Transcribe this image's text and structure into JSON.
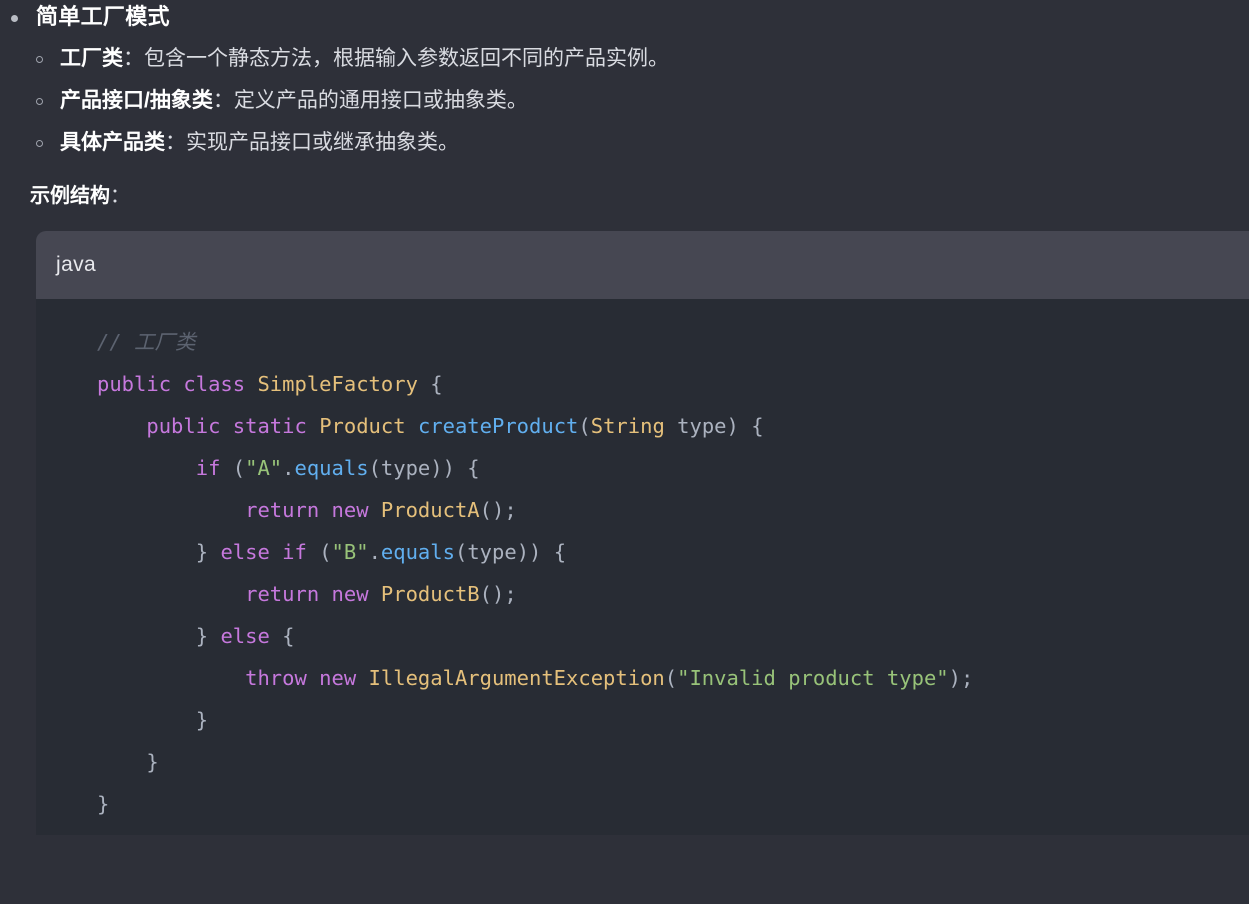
{
  "outline": {
    "title": "简单工厂模式",
    "sub_items": [
      {
        "term": "工厂类",
        "separator": "：",
        "desc": "包含一个静态方法，根据输入参数返回不同的产品实例。"
      },
      {
        "term": "产品接口/抽象类",
        "separator": "：",
        "desc": "定义产品的通用接口或抽象类。"
      },
      {
        "term": "具体产品类",
        "separator": "：",
        "desc": "实现产品接口或继承抽象类。"
      }
    ]
  },
  "section_note": {
    "label": "示例结构",
    "separator": "："
  },
  "code_block": {
    "language": "java",
    "lines": [
      [
        {
          "t": "// 工厂类",
          "c": "comment"
        }
      ],
      [
        {
          "t": "public",
          "c": "keyword"
        },
        {
          "t": " ",
          "c": "plain"
        },
        {
          "t": "class",
          "c": "keyword"
        },
        {
          "t": " ",
          "c": "plain"
        },
        {
          "t": "SimpleFactory",
          "c": "class"
        },
        {
          "t": " ",
          "c": "plain"
        },
        {
          "t": "{",
          "c": "punct"
        }
      ],
      [
        {
          "t": "    ",
          "c": "plain"
        },
        {
          "t": "public",
          "c": "keyword"
        },
        {
          "t": " ",
          "c": "plain"
        },
        {
          "t": "static",
          "c": "keyword"
        },
        {
          "t": " ",
          "c": "plain"
        },
        {
          "t": "Product",
          "c": "type"
        },
        {
          "t": " ",
          "c": "plain"
        },
        {
          "t": "createProduct",
          "c": "func"
        },
        {
          "t": "(",
          "c": "punct"
        },
        {
          "t": "String",
          "c": "type"
        },
        {
          "t": " ",
          "c": "plain"
        },
        {
          "t": "type",
          "c": "plain"
        },
        {
          "t": ") {",
          "c": "punct"
        }
      ],
      [
        {
          "t": "        ",
          "c": "plain"
        },
        {
          "t": "if",
          "c": "keyword"
        },
        {
          "t": " ",
          "c": "plain"
        },
        {
          "t": "(",
          "c": "punct"
        },
        {
          "t": "\"A\"",
          "c": "string"
        },
        {
          "t": ".",
          "c": "punct"
        },
        {
          "t": "equals",
          "c": "method"
        },
        {
          "t": "(",
          "c": "punct"
        },
        {
          "t": "type",
          "c": "plain"
        },
        {
          "t": ")) {",
          "c": "punct"
        }
      ],
      [
        {
          "t": "            ",
          "c": "plain"
        },
        {
          "t": "return",
          "c": "keyword"
        },
        {
          "t": " ",
          "c": "plain"
        },
        {
          "t": "new",
          "c": "keyword"
        },
        {
          "t": " ",
          "c": "plain"
        },
        {
          "t": "ProductA",
          "c": "class"
        },
        {
          "t": "();",
          "c": "punct"
        }
      ],
      [
        {
          "t": "        ",
          "c": "plain"
        },
        {
          "t": "}",
          "c": "punct"
        },
        {
          "t": " ",
          "c": "plain"
        },
        {
          "t": "else",
          "c": "keyword"
        },
        {
          "t": " ",
          "c": "plain"
        },
        {
          "t": "if",
          "c": "keyword"
        },
        {
          "t": " ",
          "c": "plain"
        },
        {
          "t": "(",
          "c": "punct"
        },
        {
          "t": "\"B\"",
          "c": "string"
        },
        {
          "t": ".",
          "c": "punct"
        },
        {
          "t": "equals",
          "c": "method"
        },
        {
          "t": "(",
          "c": "punct"
        },
        {
          "t": "type",
          "c": "plain"
        },
        {
          "t": ")) {",
          "c": "punct"
        }
      ],
      [
        {
          "t": "            ",
          "c": "plain"
        },
        {
          "t": "return",
          "c": "keyword"
        },
        {
          "t": " ",
          "c": "plain"
        },
        {
          "t": "new",
          "c": "keyword"
        },
        {
          "t": " ",
          "c": "plain"
        },
        {
          "t": "ProductB",
          "c": "class"
        },
        {
          "t": "();",
          "c": "punct"
        }
      ],
      [
        {
          "t": "        ",
          "c": "plain"
        },
        {
          "t": "}",
          "c": "punct"
        },
        {
          "t": " ",
          "c": "plain"
        },
        {
          "t": "else",
          "c": "keyword"
        },
        {
          "t": " ",
          "c": "plain"
        },
        {
          "t": "{",
          "c": "punct"
        }
      ],
      [
        {
          "t": "            ",
          "c": "plain"
        },
        {
          "t": "throw",
          "c": "keyword"
        },
        {
          "t": " ",
          "c": "plain"
        },
        {
          "t": "new",
          "c": "keyword"
        },
        {
          "t": " ",
          "c": "plain"
        },
        {
          "t": "IllegalArgumentException",
          "c": "class"
        },
        {
          "t": "(",
          "c": "punct"
        },
        {
          "t": "\"Invalid product type\"",
          "c": "string"
        },
        {
          "t": ");",
          "c": "punct"
        }
      ],
      [
        {
          "t": "        ",
          "c": "plain"
        },
        {
          "t": "}",
          "c": "punct"
        }
      ],
      [
        {
          "t": "    ",
          "c": "plain"
        },
        {
          "t": "}",
          "c": "punct"
        }
      ],
      [
        {
          "t": "}",
          "c": "punct"
        }
      ]
    ]
  },
  "colors": {
    "page_background": "#2e3039",
    "code_background": "#282c34",
    "code_header_background": "#464752",
    "body_text": "#d9dbe1",
    "strong_text": "#ffffff",
    "comment": "#5c6370",
    "keyword": "#c678dd",
    "class_name": "#e5c07b",
    "function": "#61afef",
    "string": "#98c379",
    "punctuation": "#abb2bf"
  }
}
